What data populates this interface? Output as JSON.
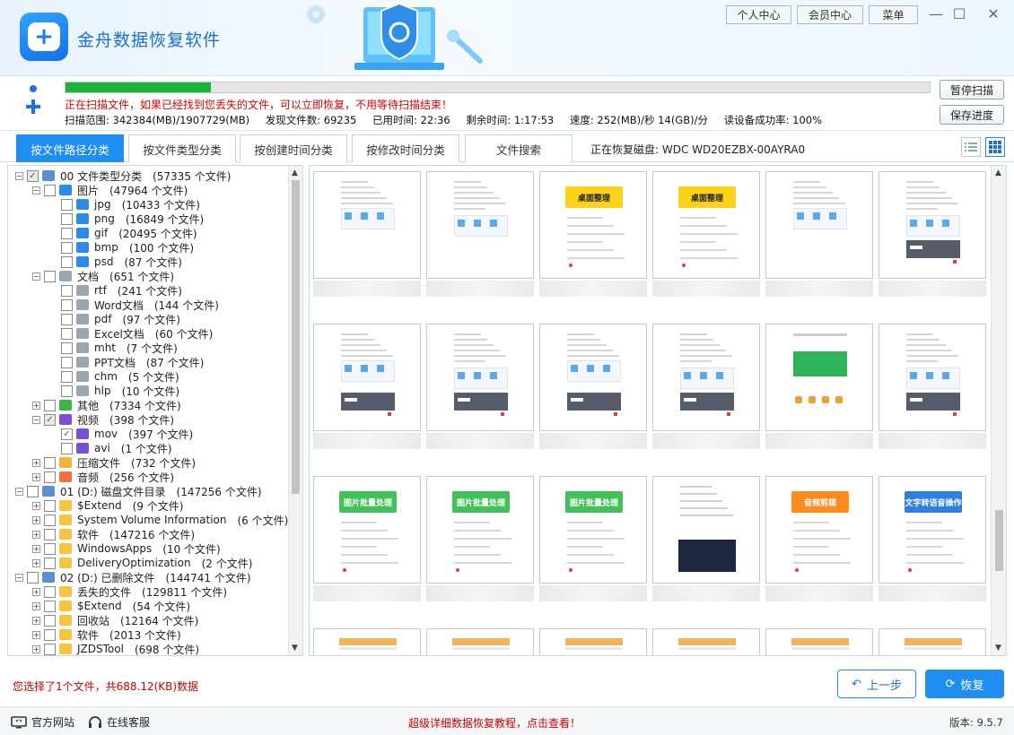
{
  "app": {
    "title": "金舟数据恢复软件"
  },
  "top_buttons": {
    "personal": "个人中心",
    "member": "会员中心",
    "menu": "菜单"
  },
  "scan": {
    "progress": 0.168,
    "message": "正在扫描文件，如果已经找到您丢失的文件，可以立即恢复，不用等待扫描结束！",
    "range": "扫描范围: 342384(MB)/1907729(MB)",
    "found": "发现文件数: 69235",
    "elapsed": "已用时间: 22:36",
    "remaining": "剩余时间: 1:17:53",
    "speed": "速度: 252(MB)/秒  14(GB)/分",
    "success_rate": "读设备成功率: 100%",
    "pause_label": "暂停扫描",
    "save_label": "保存进度"
  },
  "tabs": [
    {
      "label": "按文件路径分类",
      "active": true
    },
    {
      "label": "按文件类型分类",
      "active": false
    },
    {
      "label": "按创建时间分类",
      "active": false
    },
    {
      "label": "按修改时间分类",
      "active": false
    },
    {
      "label": "文件搜索",
      "active": false
    }
  ],
  "disk_label": "正在恢复磁盘: WDC WD20EZBX-00AYRA0",
  "tree": [
    {
      "level": 0,
      "exp": "−",
      "cb": "partial",
      "icon": "drive-icon",
      "name": "00 文件类型分类",
      "count": "(57335 个文件)"
    },
    {
      "level": 1,
      "exp": "−",
      "cb": "",
      "icon": "image-folder-icon",
      "name": "图片",
      "count": "(47964 个文件)"
    },
    {
      "level": 2,
      "exp": "",
      "cb": "",
      "icon": "image-file-icon",
      "name": "jpg",
      "count": "(10433 个文件)"
    },
    {
      "level": 2,
      "exp": "",
      "cb": "",
      "icon": "image-file-icon",
      "name": "png",
      "count": "(16849 个文件)"
    },
    {
      "level": 2,
      "exp": "",
      "cb": "",
      "icon": "image-file-icon",
      "name": "gif",
      "count": "(20495 个文件)"
    },
    {
      "level": 2,
      "exp": "",
      "cb": "",
      "icon": "image-file-icon",
      "name": "bmp",
      "count": "(100 个文件)"
    },
    {
      "level": 2,
      "exp": "",
      "cb": "",
      "icon": "image-file-icon",
      "name": "psd",
      "count": "(87 个文件)"
    },
    {
      "level": 1,
      "exp": "−",
      "cb": "",
      "icon": "doc-folder-icon",
      "name": "文档",
      "count": "(651 个文件)"
    },
    {
      "level": 2,
      "exp": "",
      "cb": "",
      "icon": "doc-folder-icon",
      "name": "rtf",
      "count": "(241 个文件)"
    },
    {
      "level": 2,
      "exp": "",
      "cb": "",
      "icon": "doc-folder-icon",
      "name": "Word文档",
      "count": "(144 个文件)"
    },
    {
      "level": 2,
      "exp": "",
      "cb": "",
      "icon": "doc-folder-icon",
      "name": "pdf",
      "count": "(97 个文件)"
    },
    {
      "level": 2,
      "exp": "",
      "cb": "",
      "icon": "doc-folder-icon",
      "name": "Excel文档",
      "count": "(60 个文件)"
    },
    {
      "level": 2,
      "exp": "",
      "cb": "",
      "icon": "doc-folder-icon",
      "name": "mht",
      "count": "(7 个文件)"
    },
    {
      "level": 2,
      "exp": "",
      "cb": "",
      "icon": "doc-folder-icon",
      "name": "PPT文档",
      "count": "(87 个文件)"
    },
    {
      "level": 2,
      "exp": "",
      "cb": "",
      "icon": "doc-folder-icon",
      "name": "chm",
      "count": "(5 个文件)"
    },
    {
      "level": 2,
      "exp": "",
      "cb": "",
      "icon": "doc-folder-icon",
      "name": "hlp",
      "count": "(10 个文件)"
    },
    {
      "level": 1,
      "exp": "+",
      "cb": "",
      "icon": "green-folder-icon",
      "name": "其他",
      "count": "(7334 个文件)"
    },
    {
      "level": 1,
      "exp": "−",
      "cb": "partial",
      "icon": "video-folder-icon",
      "name": "视频",
      "count": "(398 个文件)"
    },
    {
      "level": 2,
      "exp": "",
      "cb": "checked",
      "icon": "video-file-icon",
      "name": "mov",
      "count": "(397 个文件)"
    },
    {
      "level": 2,
      "exp": "",
      "cb": "",
      "icon": "video-file-icon",
      "name": "avi",
      "count": "(1 个文件)"
    },
    {
      "level": 1,
      "exp": "+",
      "cb": "",
      "icon": "zip-folder-icon",
      "name": "压缩文件",
      "count": "(732 个文件)"
    },
    {
      "level": 1,
      "exp": "+",
      "cb": "",
      "icon": "audio-folder-icon",
      "name": "音频",
      "count": "(256 个文件)"
    },
    {
      "level": 0,
      "exp": "−",
      "cb": "",
      "icon": "drive-icon",
      "name": "01 (D:) 磁盘文件目录",
      "count": "(147256 个文件)"
    },
    {
      "level": 1,
      "exp": "+",
      "cb": "",
      "icon": "folder-icon",
      "name": "$Extend",
      "count": "(9 个文件)"
    },
    {
      "level": 1,
      "exp": "+",
      "cb": "",
      "icon": "folder-icon",
      "name": "System Volume Information",
      "count": "(6 个文件)"
    },
    {
      "level": 1,
      "exp": "+",
      "cb": "",
      "icon": "folder-icon",
      "name": "软件",
      "count": "(147216 个文件)"
    },
    {
      "level": 1,
      "exp": "+",
      "cb": "",
      "icon": "folder-icon",
      "name": "WindowsApps",
      "count": "(10 个文件)"
    },
    {
      "level": 1,
      "exp": "+",
      "cb": "",
      "icon": "folder-icon",
      "name": "DeliveryOptimization",
      "count": "(2 个文件)"
    },
    {
      "level": 0,
      "exp": "−",
      "cb": "",
      "icon": "drive-icon",
      "name": "02 (D:) 已删除文件",
      "count": "(144741 个文件)"
    },
    {
      "level": 1,
      "exp": "+",
      "cb": "",
      "icon": "folder-icon",
      "name": "丢失的文件",
      "count": "(129811 个文件)"
    },
    {
      "level": 1,
      "exp": "+",
      "cb": "",
      "icon": "folder-icon",
      "name": "$Extend",
      "count": "(54 个文件)"
    },
    {
      "level": 1,
      "exp": "+",
      "cb": "",
      "icon": "folder-icon",
      "name": "回收站",
      "count": "(12164 个文件)"
    },
    {
      "level": 1,
      "exp": "+",
      "cb": "",
      "icon": "folder-icon",
      "name": "软件",
      "count": "(2013 个文件)"
    },
    {
      "level": 1,
      "exp": "+",
      "cb": "",
      "icon": "folder-icon",
      "name": "JZDSTool",
      "count": "(698 个文件)"
    }
  ],
  "thumbs": [
    {
      "style": "doc"
    },
    {
      "style": "doc"
    },
    {
      "style": "banner-yellow",
      "banner": "桌面整理"
    },
    {
      "style": "banner-yellow",
      "banner": "桌面整理"
    },
    {
      "style": "doc"
    },
    {
      "style": "doc"
    },
    {
      "style": "doc"
    },
    {
      "style": "doc"
    },
    {
      "style": "doc"
    },
    {
      "style": "doc"
    },
    {
      "style": "green"
    },
    {
      "style": "doc"
    },
    {
      "style": "banner-green",
      "banner": "图片批量处理"
    },
    {
      "style": "banner-green",
      "banner": "图片批量处理"
    },
    {
      "style": "banner-green",
      "banner": "图片批量处理"
    },
    {
      "style": "dark"
    },
    {
      "style": "banner-orange",
      "banner": "音频剪辑"
    },
    {
      "style": "banner-blue",
      "banner": "文字转语音操作"
    },
    {
      "style": "stripe"
    },
    {
      "style": "stripe"
    },
    {
      "style": "stripe"
    },
    {
      "style": "stripe"
    },
    {
      "style": "stripe"
    },
    {
      "style": "stripe"
    }
  ],
  "selection_info": "您选择了1个文件，共688.12(KB)数据",
  "buttons": {
    "prev": "上一步",
    "recover": "恢复"
  },
  "footer": {
    "website": "官方网站",
    "service": "在线客服",
    "tutorial": "超级详细数据恢复教程，点击查看！",
    "version": "版本: 9.5.7"
  },
  "colors": {
    "accent": "#1e8ff0",
    "progress": "#1ab33a",
    "warning": "#e00000"
  }
}
